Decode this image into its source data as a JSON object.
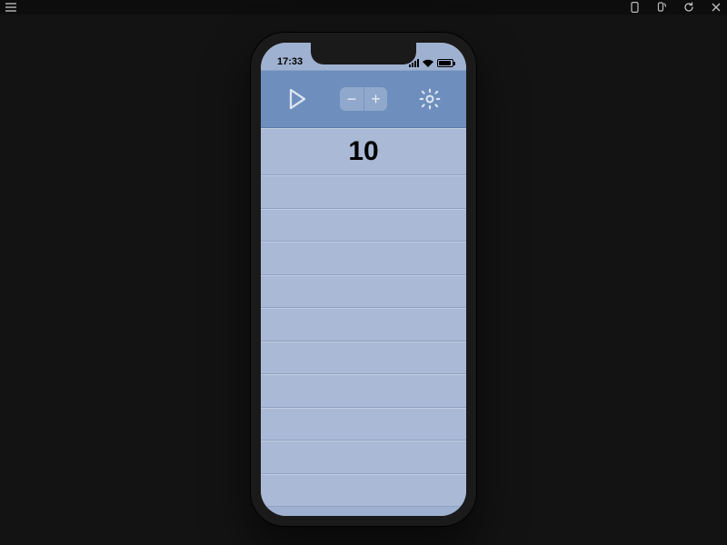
{
  "ide": {
    "menu_icon": "menu",
    "device_icon": "phone",
    "rotate_icon": "rotate",
    "reload_icon": "reload",
    "close_icon": "close"
  },
  "status": {
    "time": "17:33"
  },
  "toolbar": {
    "play_icon": "play",
    "stepper_minus": "−",
    "stepper_plus": "+",
    "settings_icon": "gear"
  },
  "list": {
    "value": "10",
    "blank_row_count": 10
  }
}
